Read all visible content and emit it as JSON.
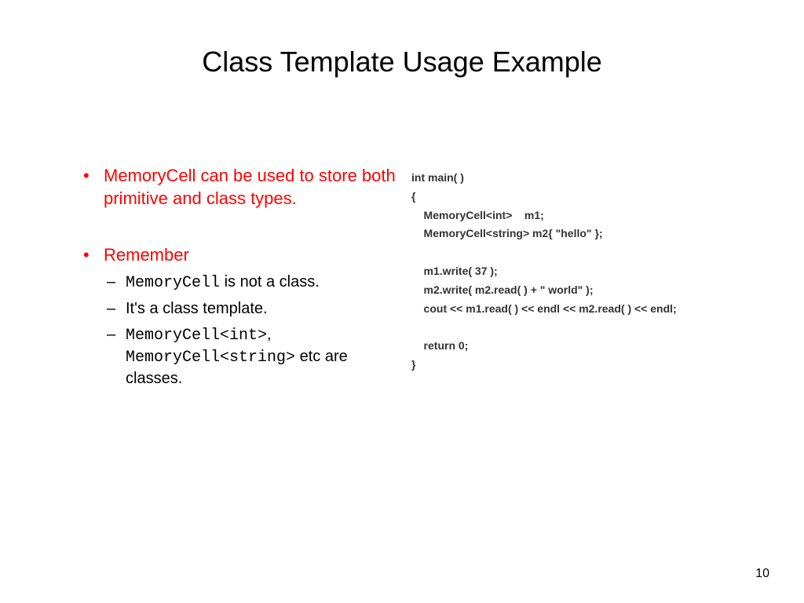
{
  "title": "Class Template Usage Example",
  "bullets": [
    {
      "text": "MemoryCell can be used to store both primitive and class types."
    },
    {
      "text": "Remember",
      "sub": [
        {
          "mono1": "MemoryCell",
          "tail": " is not a class."
        },
        {
          "text": "It's a class template."
        },
        {
          "mono1": "MemoryCell<int>",
          "mid": ", ",
          "mono2": "MemoryCell<string>",
          "tail": " etc are classes."
        }
      ]
    }
  ],
  "code": "int main( )\n{\n    MemoryCell<int>    m1;\n    MemoryCell<string> m2{ \"hello\" };\n\n    m1.write( 37 );\n    m2.write( m2.read( ) + \" world\" );\n    cout << m1.read( ) << endl << m2.read( ) << endl;\n\n    return 0;\n}",
  "page": "10"
}
